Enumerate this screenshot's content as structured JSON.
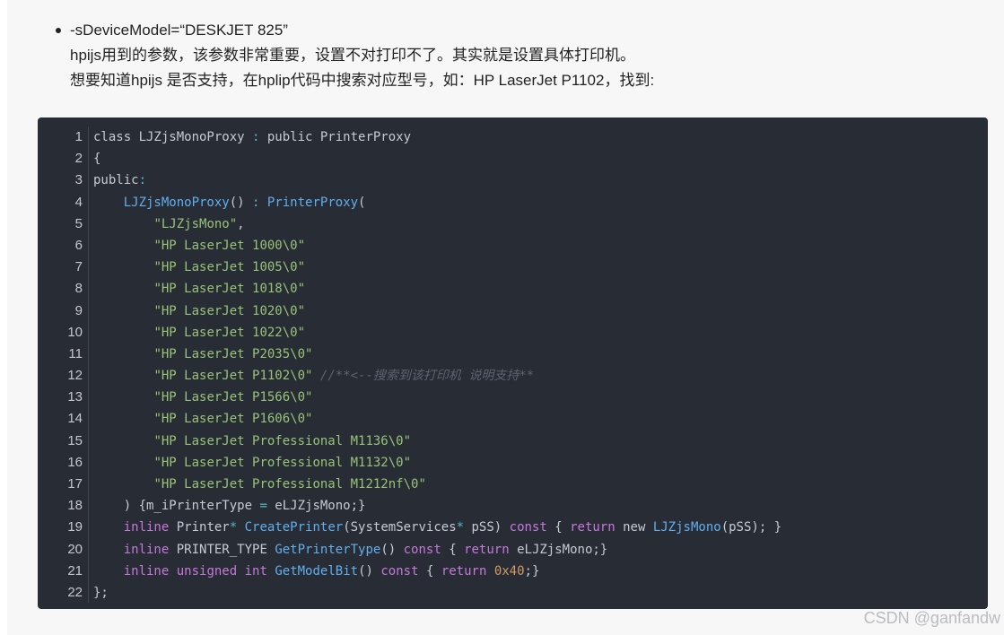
{
  "article": {
    "bullet_title": "-sDeviceModel=“DESKJET 825”",
    "desc_line_1": "hpijs用到的参数，该参数非常重要，设置不对打印不了。其实就是设置具体打印机。",
    "desc_line_2": "想要知道hpijs 是否支持，在hplip代码中搜索对应型号，如：HP LaserJet P1102，找到:"
  },
  "code_block": {
    "line_numbers": [
      "1",
      "2",
      "3",
      "4",
      "5",
      "6",
      "7",
      "8",
      "9",
      "10",
      "11",
      "12",
      "13",
      "14",
      "15",
      "16",
      "17",
      "18",
      "19",
      "20",
      "21",
      "22"
    ],
    "lines": [
      [
        {
          "t": "class LJZjsMonoProxy ",
          "c": "plain"
        },
        {
          "t": ": ",
          "c": "op"
        },
        {
          "t": "public PrinterProxy",
          "c": "plain"
        }
      ],
      [
        {
          "t": "{",
          "c": "plain"
        }
      ],
      [
        {
          "t": "public",
          "c": "plain"
        },
        {
          "t": ":",
          "c": "op"
        }
      ],
      [
        {
          "t": "    ",
          "c": "plain"
        },
        {
          "t": "LJZjsMonoProxy",
          "c": "fn"
        },
        {
          "t": "() ",
          "c": "plain"
        },
        {
          "t": ": ",
          "c": "op"
        },
        {
          "t": "PrinterProxy",
          "c": "fn"
        },
        {
          "t": "(",
          "c": "plain"
        }
      ],
      [
        {
          "t": "        ",
          "c": "plain"
        },
        {
          "t": "\"LJZjsMono\"",
          "c": "str"
        },
        {
          "t": ",",
          "c": "plain"
        }
      ],
      [
        {
          "t": "        ",
          "c": "plain"
        },
        {
          "t": "\"HP LaserJet 1000\\0\"",
          "c": "str"
        }
      ],
      [
        {
          "t": "        ",
          "c": "plain"
        },
        {
          "t": "\"HP LaserJet 1005\\0\"",
          "c": "str"
        }
      ],
      [
        {
          "t": "        ",
          "c": "plain"
        },
        {
          "t": "\"HP LaserJet 1018\\0\"",
          "c": "str"
        }
      ],
      [
        {
          "t": "        ",
          "c": "plain"
        },
        {
          "t": "\"HP LaserJet 1020\\0\"",
          "c": "str"
        }
      ],
      [
        {
          "t": "        ",
          "c": "plain"
        },
        {
          "t": "\"HP LaserJet 1022\\0\"",
          "c": "str"
        }
      ],
      [
        {
          "t": "        ",
          "c": "plain"
        },
        {
          "t": "\"HP LaserJet P2035\\0\"",
          "c": "str"
        }
      ],
      [
        {
          "t": "        ",
          "c": "plain"
        },
        {
          "t": "\"HP LaserJet P1102\\0\"",
          "c": "str"
        },
        {
          "t": " ",
          "c": "plain"
        },
        {
          "t": "//**<--搜索到该打印机 说明支持**",
          "c": "cm"
        }
      ],
      [
        {
          "t": "        ",
          "c": "plain"
        },
        {
          "t": "\"HP LaserJet P1566\\0\"",
          "c": "str"
        }
      ],
      [
        {
          "t": "        ",
          "c": "plain"
        },
        {
          "t": "\"HP LaserJet P1606\\0\"",
          "c": "str"
        }
      ],
      [
        {
          "t": "        ",
          "c": "plain"
        },
        {
          "t": "\"HP LaserJet Professional M1136\\0\"",
          "c": "str"
        }
      ],
      [
        {
          "t": "        ",
          "c": "plain"
        },
        {
          "t": "\"HP LaserJet Professional M1132\\0\"",
          "c": "str"
        }
      ],
      [
        {
          "t": "        ",
          "c": "plain"
        },
        {
          "t": "\"HP LaserJet Professional M1212nf\\0\"",
          "c": "str"
        }
      ],
      [
        {
          "t": "    ) {m_iPrinterType ",
          "c": "plain"
        },
        {
          "t": "=",
          "c": "op"
        },
        {
          "t": " eLJZjsMono;}",
          "c": "plain"
        }
      ],
      [
        {
          "t": "    ",
          "c": "plain"
        },
        {
          "t": "inline",
          "c": "kw"
        },
        {
          "t": " Printer",
          "c": "plain"
        },
        {
          "t": "*",
          "c": "op"
        },
        {
          "t": " ",
          "c": "plain"
        },
        {
          "t": "CreatePrinter",
          "c": "fn"
        },
        {
          "t": "(SystemServices",
          "c": "plain"
        },
        {
          "t": "*",
          "c": "op"
        },
        {
          "t": " pSS) ",
          "c": "plain"
        },
        {
          "t": "const",
          "c": "kw"
        },
        {
          "t": " { ",
          "c": "plain"
        },
        {
          "t": "return",
          "c": "kw"
        },
        {
          "t": " new ",
          "c": "plain"
        },
        {
          "t": "LJZjsMono",
          "c": "fn"
        },
        {
          "t": "(pSS); }",
          "c": "plain"
        }
      ],
      [
        {
          "t": "    ",
          "c": "plain"
        },
        {
          "t": "inline",
          "c": "kw"
        },
        {
          "t": " PRINTER_TYPE ",
          "c": "plain"
        },
        {
          "t": "GetPrinterType",
          "c": "fn"
        },
        {
          "t": "() ",
          "c": "plain"
        },
        {
          "t": "const",
          "c": "kw"
        },
        {
          "t": " { ",
          "c": "plain"
        },
        {
          "t": "return",
          "c": "kw"
        },
        {
          "t": " eLJZjsMono;}",
          "c": "plain"
        }
      ],
      [
        {
          "t": "    ",
          "c": "plain"
        },
        {
          "t": "inline",
          "c": "kw"
        },
        {
          "t": " ",
          "c": "plain"
        },
        {
          "t": "unsigned",
          "c": "kw"
        },
        {
          "t": " ",
          "c": "plain"
        },
        {
          "t": "int",
          "c": "kw"
        },
        {
          "t": " ",
          "c": "plain"
        },
        {
          "t": "GetModelBit",
          "c": "fn"
        },
        {
          "t": "() ",
          "c": "plain"
        },
        {
          "t": "const",
          "c": "kw"
        },
        {
          "t": " { ",
          "c": "plain"
        },
        {
          "t": "return",
          "c": "kw"
        },
        {
          "t": " ",
          "c": "plain"
        },
        {
          "t": "0x40",
          "c": "num"
        },
        {
          "t": ";}",
          "c": "plain"
        }
      ],
      [
        {
          "t": "};",
          "c": "plain"
        }
      ]
    ]
  },
  "watermark": "CSDN @ganfandw",
  "colors": {
    "code_bg": "#282c34",
    "keyword": "#c678dd",
    "function": "#61afef",
    "string": "#98c379",
    "comment": "#5c6370",
    "number": "#d19a66"
  }
}
